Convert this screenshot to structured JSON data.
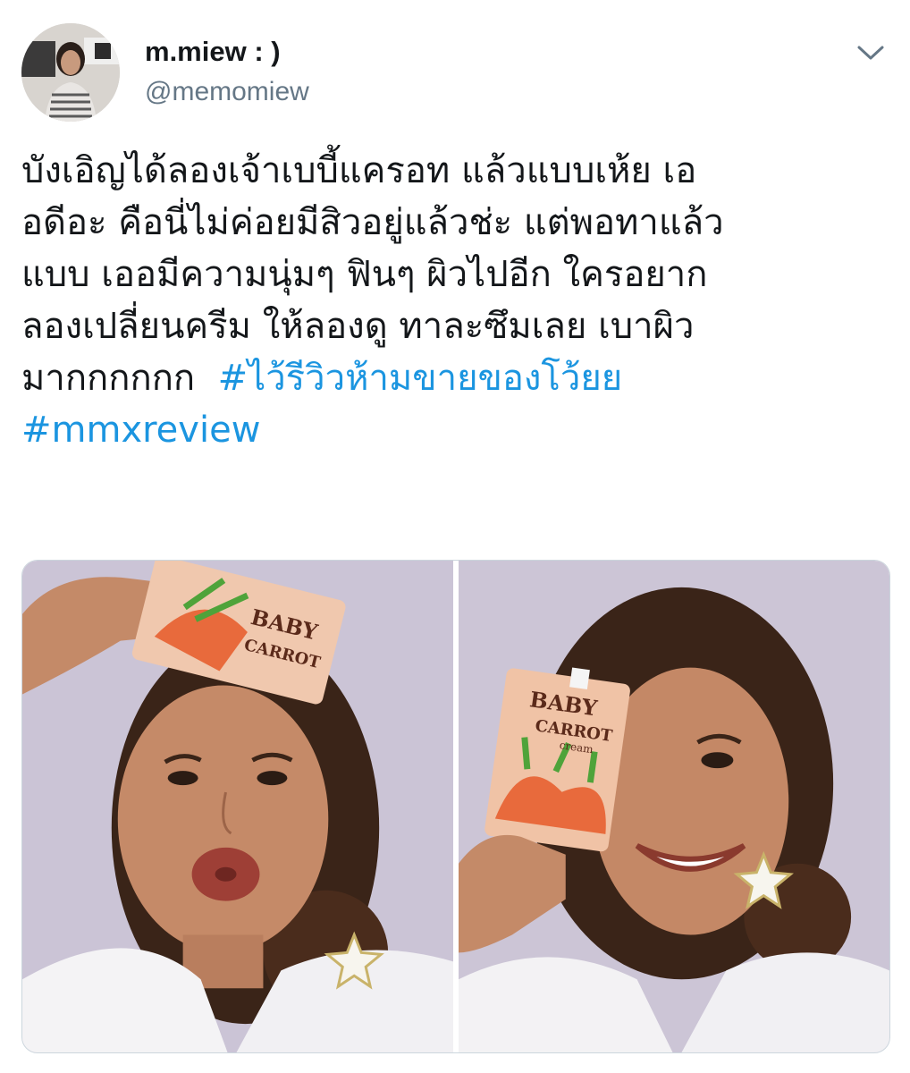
{
  "tweet": {
    "display_name": "m.miew : )",
    "handle": "@memomiew",
    "text_lines": [
      "บังเอิญได้ลองเจ้าเบบี้แครอท แล้วแบบเห้ย เอ",
      "อดีอะ คือนี่ไม่ค่อยมีสิวอยู่แล้วช่ะ แต่พอทาแล้ว",
      "แบบ เออมีความนุ่มๆ ฟินๆ ผิวไปอีก ใครอยาก",
      "ลองเปลี่ยนครีม ให้ลองดู ทาละซึมเลย เบาผิว",
      "มากกกกกก"
    ],
    "hashtags": [
      "#ไว้รีวิวห้ามขายของโว้ยย",
      "#mmxreview"
    ]
  },
  "media": {
    "photos": [
      {
        "icon": "photo-left",
        "product_text": [
          "BABY",
          "CARROT"
        ]
      },
      {
        "icon": "photo-right",
        "product_text": [
          "BABY",
          "CARROT",
          "cream"
        ]
      }
    ]
  },
  "colors": {
    "text": "#14171a",
    "secondary": "#657786",
    "link": "#1b95e0",
    "border": "#ccd6dd"
  },
  "icons": {
    "caret": "chevron-down-icon",
    "avatar": "avatar"
  }
}
